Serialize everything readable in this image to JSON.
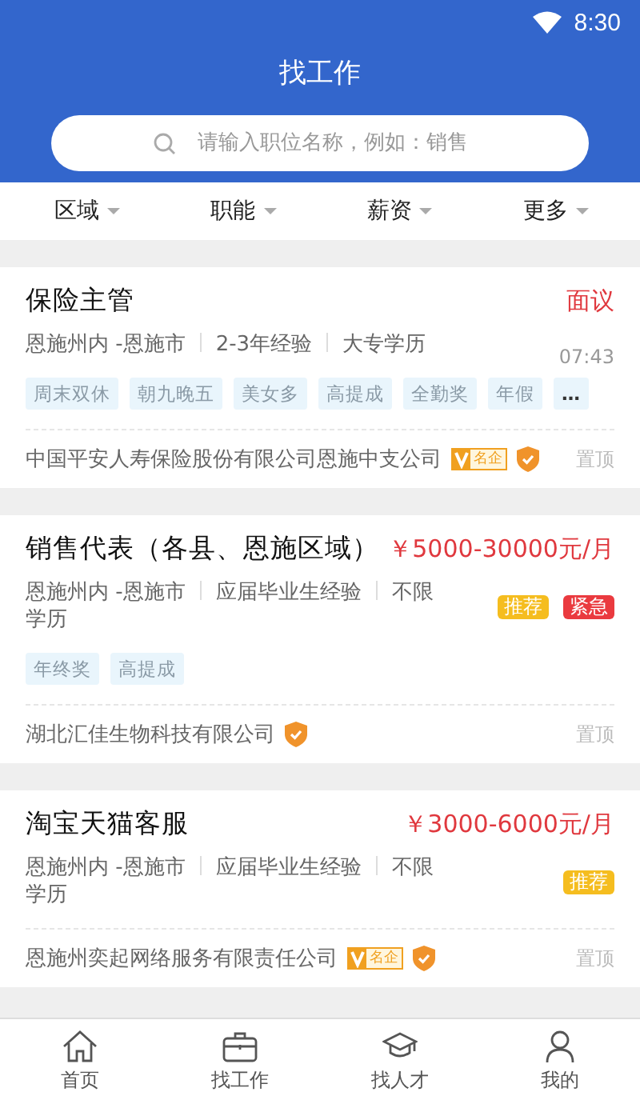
{
  "status_bar": {
    "time": "8:30"
  },
  "header": {
    "title": "找工作",
    "search": {
      "placeholder": "请输入职位名称，例如：销售"
    }
  },
  "filters": [
    {
      "label": "区域"
    },
    {
      "label": "职能"
    },
    {
      "label": "薪资"
    },
    {
      "label": "更多"
    }
  ],
  "jobs": [
    {
      "title": "保险主管",
      "salary": "面议",
      "location": "恩施州内 -恩施市",
      "experience": "2-3年经验",
      "education": "大专学历",
      "time": "07:43",
      "tags": [
        "周末双休",
        "朝九晚五",
        "美女多",
        "高提成",
        "全勤奖",
        "年假"
      ],
      "more_tags": "…",
      "company": "中国平安人寿保险股份有限公司恩施中支公司",
      "famous": "名企",
      "verified": true,
      "pin": "置顶"
    },
    {
      "title": "销售代表（各县、恩施区域）",
      "salary": "￥5000-30000元/月",
      "location": "恩施州内 -恩施市",
      "experience": "应届毕业生经验",
      "education": "不限学历",
      "tags": [
        "年终奖",
        "高提成"
      ],
      "badges": [
        {
          "kind": "recommend",
          "label": "推荐"
        },
        {
          "kind": "urgent",
          "label": "紧急"
        }
      ],
      "company": "湖北汇佳生物科技有限公司",
      "verified": true,
      "pin": "置顶"
    },
    {
      "title": "淘宝天猫客服",
      "salary": "￥3000-6000元/月",
      "location": "恩施州内 -恩施市",
      "experience": "应届毕业生经验",
      "education": "不限学历",
      "badges": [
        {
          "kind": "recommend",
          "label": "推荐"
        }
      ],
      "company": "恩施州奕起网络服务有限责任公司",
      "famous": "名企",
      "verified": true,
      "pin": "置顶"
    }
  ],
  "bottom_nav": [
    {
      "label": "首页"
    },
    {
      "label": "找工作"
    },
    {
      "label": "找人才"
    },
    {
      "label": "我的"
    }
  ]
}
